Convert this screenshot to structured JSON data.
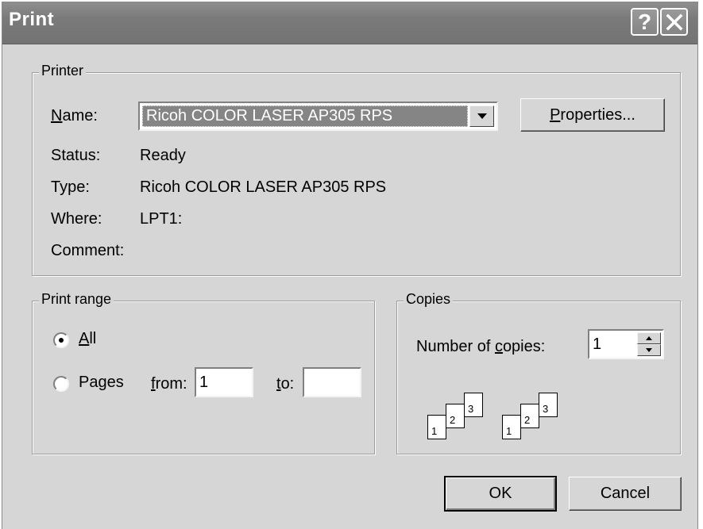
{
  "window": {
    "title": "Print"
  },
  "printer": {
    "group_label": "Printer",
    "name_label": "Name:",
    "name_value": "Ricoh COLOR LASER AP305 RPS",
    "properties_button": "Properties...",
    "status_label": "Status:",
    "status_value": "Ready",
    "type_label": "Type:",
    "type_value": "Ricoh COLOR LASER AP305 RPS",
    "where_label": "Where:",
    "where_value": "LPT1:",
    "comment_label": "Comment:",
    "comment_value": ""
  },
  "print_range": {
    "group_label": "Print range",
    "all_label": "All",
    "pages_label": "Pages",
    "from_label": "from:",
    "from_value": "1",
    "to_label": "to:",
    "to_value": "",
    "selected": "All"
  },
  "copies": {
    "group_label": "Copies",
    "number_label": "Number of copies:",
    "number_value": "1",
    "collate_pages": [
      "1",
      "2",
      "3"
    ]
  },
  "buttons": {
    "ok": "OK",
    "cancel": "Cancel"
  },
  "icons": {
    "help": "help-icon",
    "close": "close-icon",
    "dropdown": "chevron-down-icon"
  }
}
